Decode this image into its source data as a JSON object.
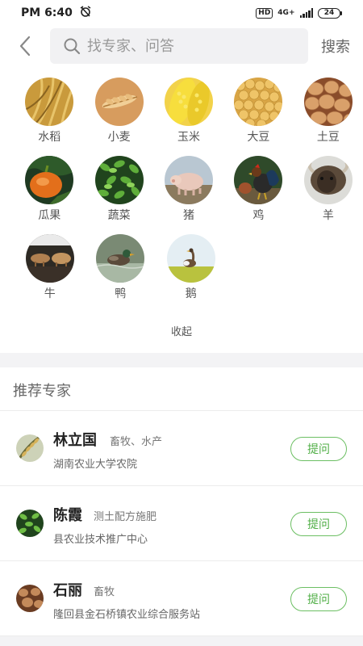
{
  "status_bar": {
    "time": "PM 6:40",
    "hd": "HD",
    "network": "4G+",
    "battery": "24"
  },
  "search": {
    "placeholder": "找专家、问答",
    "button_label": "搜索"
  },
  "categories": [
    {
      "label": "水稻",
      "icon": "rice"
    },
    {
      "label": "小麦",
      "icon": "wheat"
    },
    {
      "label": "玉米",
      "icon": "corn"
    },
    {
      "label": "大豆",
      "icon": "soybean"
    },
    {
      "label": "土豆",
      "icon": "potato"
    },
    {
      "label": "瓜果",
      "icon": "fruit"
    },
    {
      "label": "蔬菜",
      "icon": "vegetable"
    },
    {
      "label": "猪",
      "icon": "pig"
    },
    {
      "label": "鸡",
      "icon": "chicken"
    },
    {
      "label": "羊",
      "icon": "sheep"
    },
    {
      "label": "牛",
      "icon": "cattle"
    },
    {
      "label": "鸭",
      "icon": "duck"
    },
    {
      "label": "鹅",
      "icon": "goose"
    }
  ],
  "collapse_label": "收起",
  "recommend_title": "推荐专家",
  "experts": [
    {
      "name": "林立国",
      "field": "畜牧、水产",
      "org": "湖南农业大学农院",
      "ask": "提问"
    },
    {
      "name": "陈霞",
      "field": "测土配方施肥",
      "org": "县农业技术推广中心",
      "ask": "提问"
    },
    {
      "name": "石丽",
      "field": "畜牧",
      "org": "隆回县金石桥镇农业综合服务站",
      "ask": "提问"
    }
  ],
  "colors": {
    "accent_green": "#4fae45",
    "search_bg": "#f1f1f3",
    "section_gap": "#f3f3f5"
  }
}
